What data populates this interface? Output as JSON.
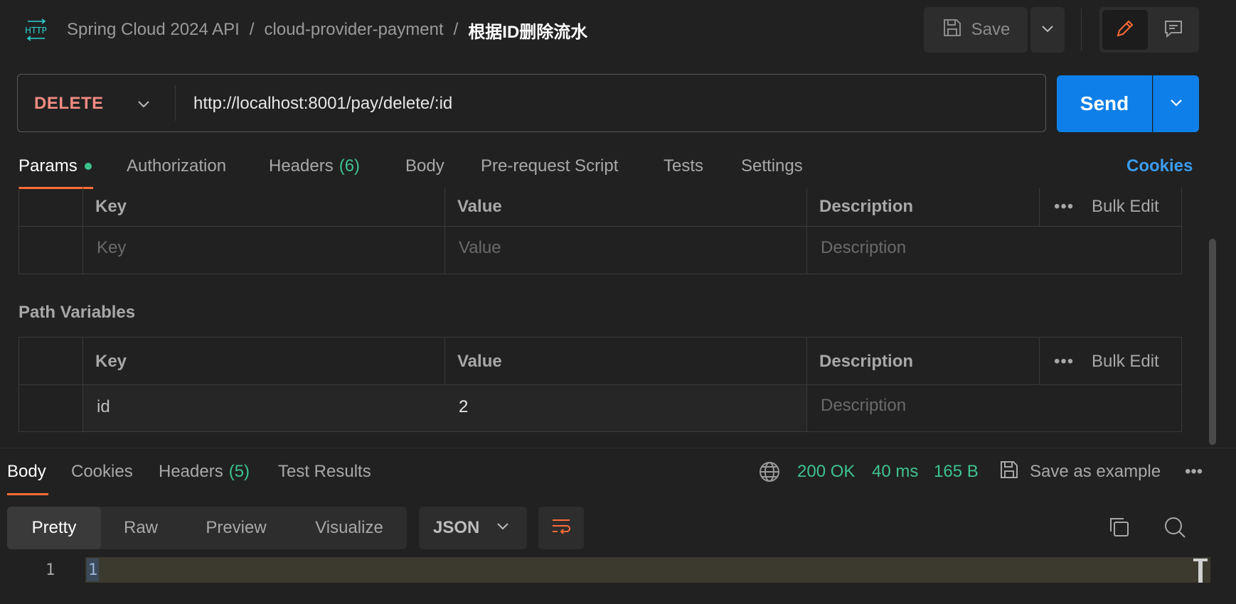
{
  "header": {
    "breadcrumb": {
      "collection": "Spring Cloud 2024 API",
      "folder": "cloud-provider-payment",
      "request": "根据ID删除流水",
      "separator": "/"
    },
    "save_label": "Save",
    "icons": [
      "http-icon",
      "save-icon",
      "chevron-down-icon",
      "pencil-icon",
      "comment-icon"
    ]
  },
  "request": {
    "method": "DELETE",
    "url": "http://localhost:8001/pay/delete/:id",
    "send_label": "Send"
  },
  "tabs": {
    "params": "Params",
    "authorization": "Authorization",
    "headers": "Headers",
    "headers_count": "(6)",
    "body": "Body",
    "prerequest": "Pre-request Script",
    "tests": "Tests",
    "settings": "Settings",
    "cookies": "Cookies"
  },
  "query_table": {
    "col_key": "Key",
    "col_value": "Value",
    "col_description": "Description",
    "more": "•••",
    "bulk_edit": "Bulk Edit",
    "placeholder_key": "Key",
    "placeholder_value": "Value",
    "placeholder_description": "Description"
  },
  "path_variables": {
    "title": "Path Variables",
    "col_key": "Key",
    "col_value": "Value",
    "col_description": "Description",
    "more": "•••",
    "bulk_edit": "Bulk Edit",
    "rows": [
      {
        "key": "id",
        "value": "2",
        "description_placeholder": "Description"
      }
    ]
  },
  "response": {
    "tabs": {
      "body": "Body",
      "cookies": "Cookies",
      "headers": "Headers",
      "headers_count": "(5)",
      "test_results": "Test Results"
    },
    "status": "200 OK",
    "time": "40 ms",
    "size": "165 B",
    "save_example": "Save as example",
    "more": "•••",
    "views": [
      "Pretty",
      "Raw",
      "Preview",
      "Visualize"
    ],
    "active_view": "Pretty",
    "format": "JSON",
    "lines": [
      {
        "number": "1",
        "text": "1"
      }
    ]
  },
  "colors": {
    "accent": "#ff6c37",
    "send": "#0e7fe8",
    "method_delete": "#f28b82",
    "success": "#3ec28f",
    "link": "#3a9cf0",
    "background": "#212121"
  }
}
